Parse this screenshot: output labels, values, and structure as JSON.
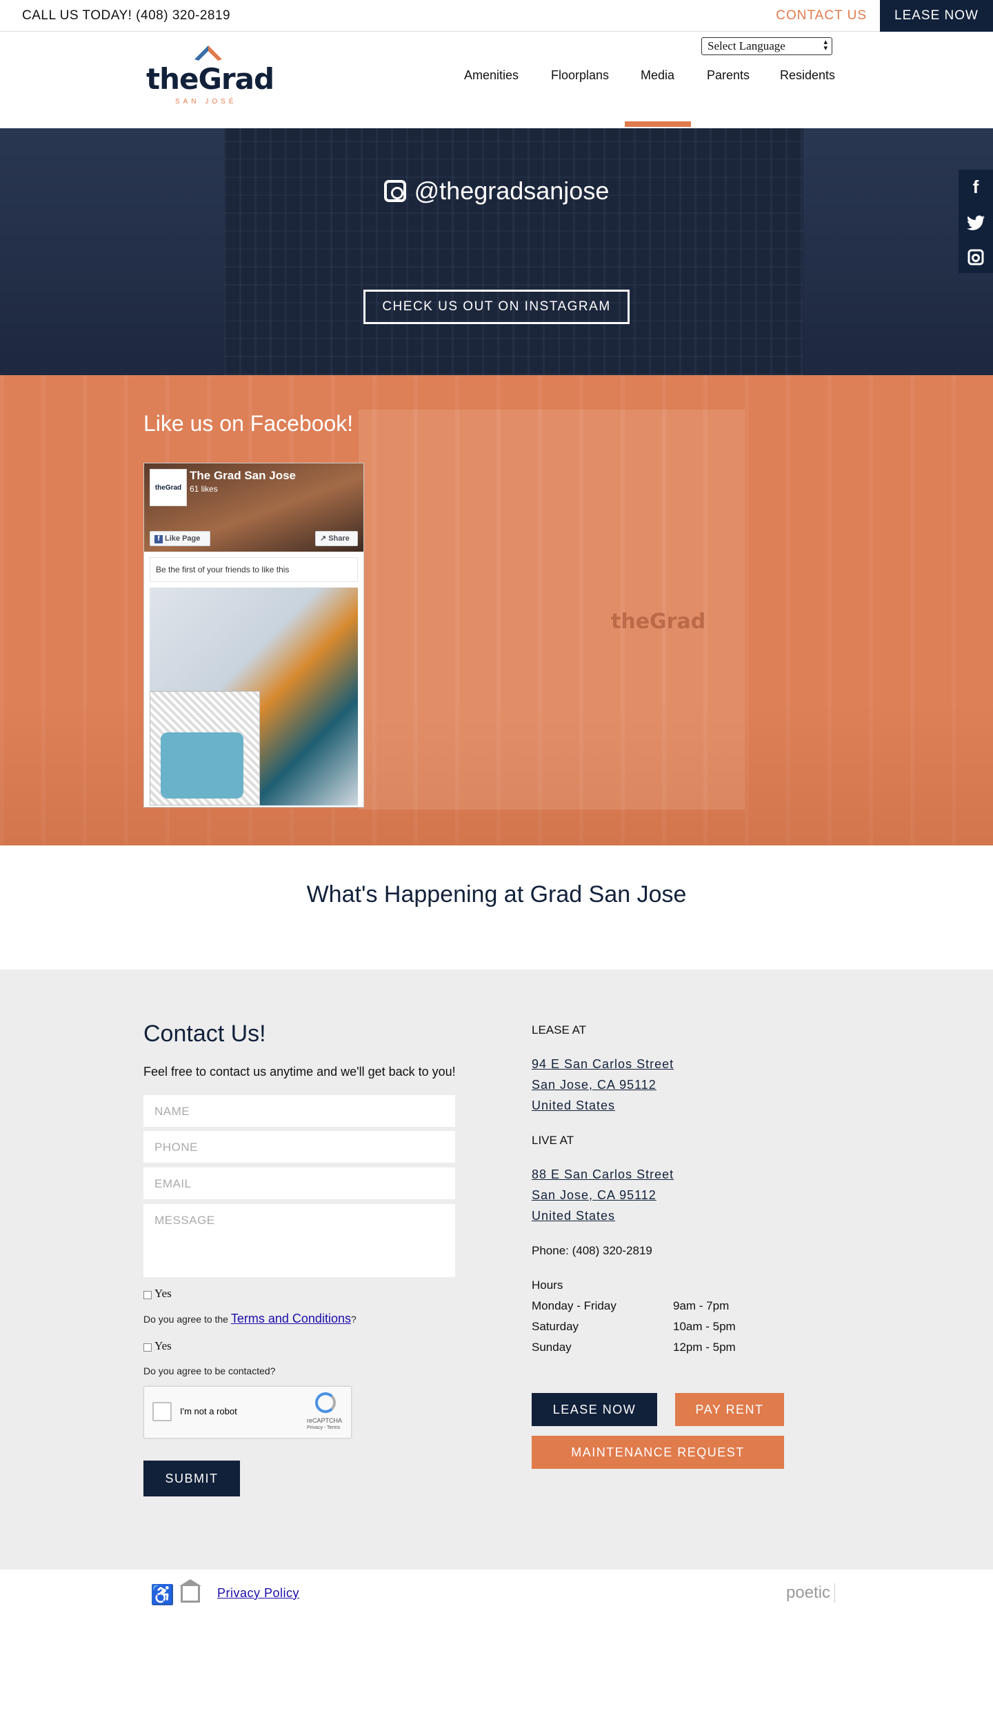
{
  "topbar": {
    "call": "CALL US TODAY! (408) 320-2819",
    "contact": "CONTACT US",
    "lease": "LEASE NOW"
  },
  "header": {
    "logo_text": "theGrad",
    "logo_sub": "SAN JOSÉ",
    "language": "Select Language",
    "nav": [
      "Amenities",
      "Floorplans",
      "Media",
      "Parents",
      "Residents"
    ],
    "active_nav": "Media"
  },
  "instagram": {
    "handle": "@thegradsanjose",
    "button": "CHECK US OUT ON INSTAGRAM"
  },
  "social": {
    "icons": [
      "facebook-icon",
      "twitter-icon",
      "instagram-icon"
    ]
  },
  "facebook": {
    "title": "Like us on Facebook!",
    "widget": {
      "avatar_text": "theGrad",
      "page_name": "The Grad San Jose",
      "likes": "61 likes",
      "like_button": "Like Page",
      "share_button": "Share",
      "friends_text": "Be the first of your friends to like this"
    },
    "building_sign": "theGrad"
  },
  "happening": {
    "title": "What's Happening at Grad San Jose"
  },
  "contact": {
    "title": "Contact Us!",
    "intro": "Feel free to contact us anytime and we'll get back to you!",
    "placeholders": {
      "name": "NAME",
      "phone": "PHONE",
      "email": "EMAIL",
      "message": "MESSAGE"
    },
    "yes": "Yes",
    "agree_terms_prefix": "Do you agree to the",
    "terms_link": "Terms and Conditions",
    "agree_terms_suffix": "?",
    "agree_contact": "Do you agree to be contacted?",
    "captcha": {
      "label": "I'm not a robot",
      "brand": "reCAPTCHA",
      "links": "Privacy - Terms"
    },
    "submit": "SUBMIT"
  },
  "info": {
    "lease_at": "LEASE AT",
    "lease_address": [
      "94 E San Carlos Street",
      "San Jose, CA 95112",
      "United States"
    ],
    "live_at": "LIVE AT",
    "live_address": [
      "88 E San Carlos Street",
      "San Jose, CA 95112",
      "United States"
    ],
    "phone": "Phone: (408) 320-2819",
    "hours_title": "Hours",
    "hours": [
      {
        "day": "Monday - Friday",
        "time": "9am - 7pm"
      },
      {
        "day": "Saturday",
        "time": "10am - 5pm"
      },
      {
        "day": "Sunday",
        "time": "12pm - 5pm"
      }
    ],
    "buttons": {
      "lease": "LEASE NOW",
      "pay": "PAY RENT",
      "maintenance": "MAINTENANCE REQUEST"
    }
  },
  "footer": {
    "privacy": "Privacy Policy",
    "brand": "poetic"
  },
  "colors": {
    "navy": "#12213a",
    "orange": "#e07b4c",
    "light_gray": "#ededed"
  }
}
